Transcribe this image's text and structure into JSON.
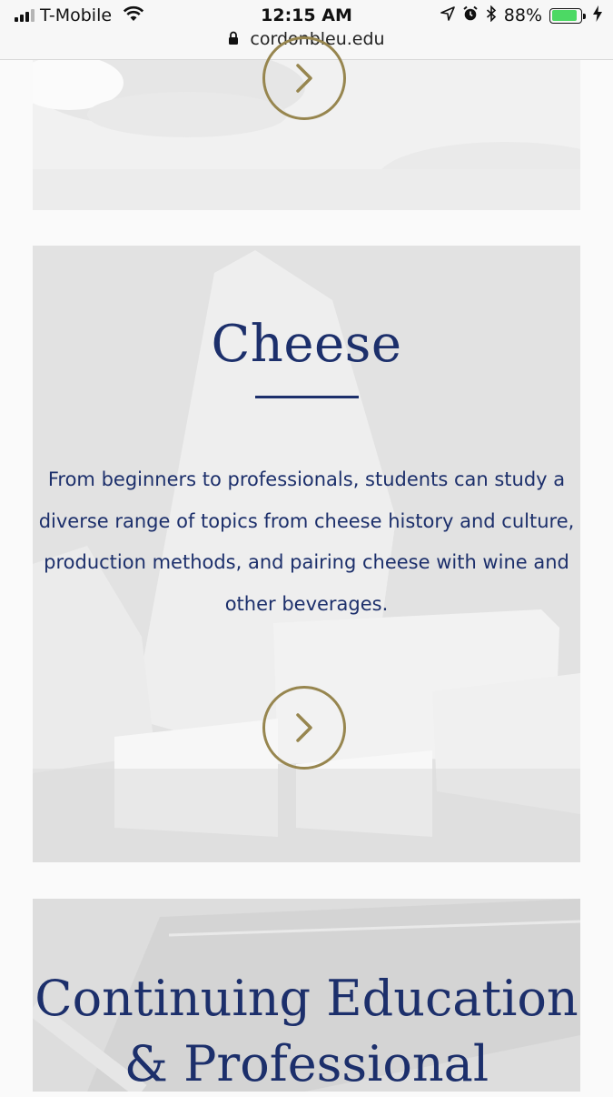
{
  "status_bar": {
    "carrier": "T-Mobile",
    "time": "12:15 AM",
    "battery_percent": "88%",
    "battery_level": 0.88,
    "url": "cordonbleu.edu",
    "icons": [
      "signal-icon",
      "wifi-icon",
      "location-arrow-icon",
      "alarm-icon",
      "bluetooth-icon",
      "battery-icon",
      "charging-icon",
      "lock-icon"
    ]
  },
  "cards": {
    "cheese": {
      "title": "Cheese",
      "description": "From beginners to professionals, students can study a diverse range of topics from cheese history and culture, production methods, and pairing cheese with wine and other beverages."
    },
    "continuing_education": {
      "title": "Continuing Education & Professional"
    }
  },
  "colors": {
    "title": "#1c2f6b",
    "accent_gold": "#97864f",
    "battery_green": "#4cd964"
  }
}
